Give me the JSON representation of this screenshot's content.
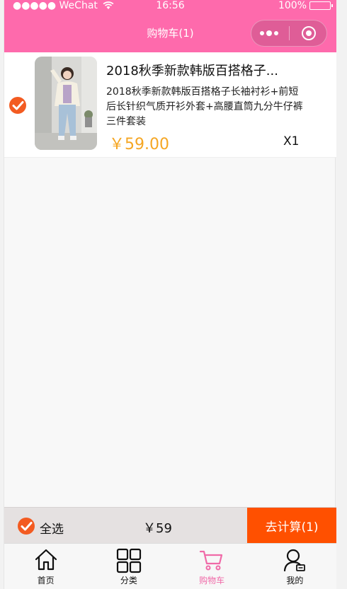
{
  "status": {
    "carrier": "●●●●● WeChat",
    "time": "16:56",
    "battery": "100%"
  },
  "nav": {
    "title": "购物车(1)"
  },
  "cart": {
    "items": [
      {
        "title": "2018秋季新款韩版百搭格子...",
        "description": "2018秋季新款韩版百搭格子长袖衬衫+前短后长针织气质开衫外套+高腰直筒九分牛仔裤三件套装",
        "price": "￥59.00",
        "quantity": "X1",
        "checked": true
      }
    ]
  },
  "checkout": {
    "select_all_label": "全选",
    "total": "￥59",
    "button_label": "去计算(1)"
  },
  "tabs": [
    {
      "label": "首页",
      "icon": "home-icon"
    },
    {
      "label": "分类",
      "icon": "category-grid-icon"
    },
    {
      "label": "购物车",
      "icon": "cart-icon",
      "active": true
    },
    {
      "label": "我的",
      "icon": "user-icon"
    }
  ],
  "colors": {
    "nav_bg": "#fe6aac",
    "check": "#f35b21",
    "price": "#f5a623",
    "checkout_button": "#ff5000",
    "tab_active": "#f06aa8"
  }
}
